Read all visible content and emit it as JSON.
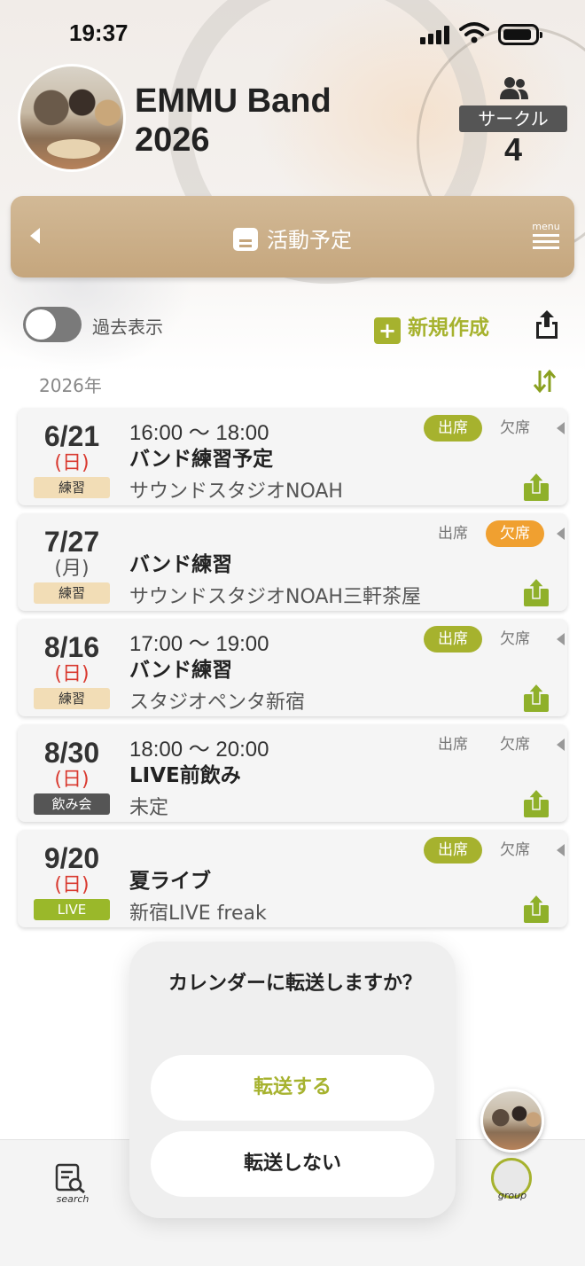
{
  "status_bar": {
    "time": "19:37"
  },
  "header": {
    "group_name_line1": "EMMU Band",
    "group_name_line2": "2026",
    "circle_label": "サークル",
    "member_count": "4"
  },
  "nav": {
    "title": "活動予定",
    "menu_label": "menu"
  },
  "controls": {
    "past_toggle_label": "過去表示",
    "new_button_label": "新規作成"
  },
  "year_label": "2026年",
  "rsvp_labels": {
    "attend": "出席",
    "absent": "欠席"
  },
  "events": [
    {
      "date": "6/21",
      "dow": "(日)",
      "category": "練習",
      "time": "16:00 〜 18:00",
      "title": "バンド練習予定",
      "place": "サウンドスタジオNOAH"
    },
    {
      "date": "7/27",
      "dow": "(月)",
      "category": "練習",
      "time": "",
      "title": "バンド練習",
      "place": "サウンドスタジオNOAH三軒茶屋"
    },
    {
      "date": "8/16",
      "dow": "(日)",
      "category": "練習",
      "time": "17:00 〜 19:00",
      "title": "バンド練習",
      "place": "スタジオペンタ新宿"
    },
    {
      "date": "8/30",
      "dow": "(日)",
      "category": "飲み会",
      "time": "18:00 〜 20:00",
      "title": "LIVE前飲み",
      "place": "未定"
    },
    {
      "date": "9/20",
      "dow": "(日)",
      "category": "LIVE",
      "time": "",
      "title": "夏ライブ",
      "place": "新宿LIVE freak"
    }
  ],
  "dialog": {
    "message": "カレンダーに転送しますか？",
    "confirm_label": "転送する",
    "cancel_label": "転送しない"
  },
  "tab_bar": {
    "search_label": "search",
    "group_label": "group"
  },
  "colors": {
    "accent_green": "#a6b22e",
    "absent_orange": "#f0a030",
    "sunday_red": "#d9392f",
    "banner_beige": "#c5a67d"
  }
}
